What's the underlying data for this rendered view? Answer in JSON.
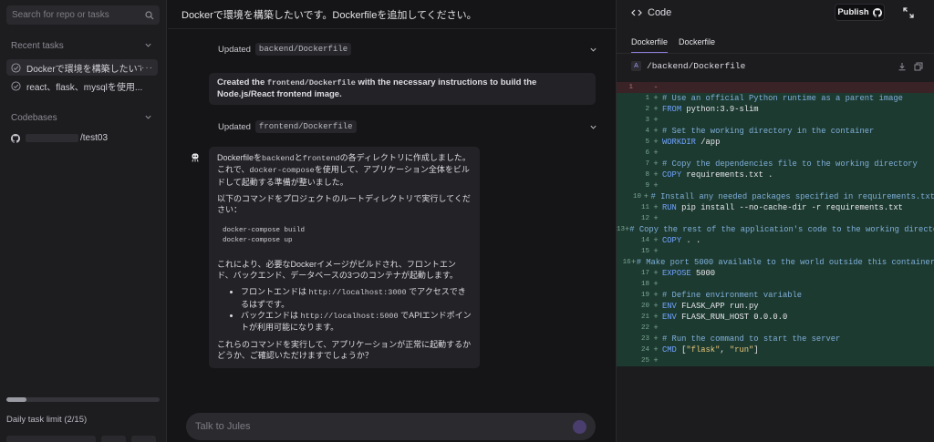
{
  "sidebar": {
    "search_placeholder": "Search for repo or tasks",
    "recent_tasks_label": "Recent tasks",
    "tasks": [
      {
        "label": "Dockerで環境を構築したいで...",
        "more": "···"
      },
      {
        "label": "react、flask、mysqlを使用..."
      }
    ],
    "codebases_label": "Codebases",
    "codebase": {
      "name": "/test03"
    },
    "daily_limit_text": "Daily task limit (2/15)",
    "daily_limit_fraction": 0.133
  },
  "chat": {
    "title": "Dockerで環境を構築したいです。Dockerfileを追加してください。",
    "updated1": {
      "label": "Updated",
      "path": "backend/Dockerfile"
    },
    "created_msg": {
      "pre": "Created the ",
      "code": "frontend/Dockerfile",
      "post": " with the necessary instructions to build the Node.js/React frontend image."
    },
    "updated2": {
      "label": "Updated",
      "path": "frontend/Dockerfile"
    },
    "reply": {
      "p1_a": "Dockerfileを",
      "p1_code1": "backend",
      "p1_b": "と",
      "p1_code2": "frontend",
      "p1_c": "の各ディレクトリに作成しました。これで、",
      "p1_code3": "docker-compose",
      "p1_d": "を使用して、アプリケーション全体をビルドして起動する準備が整いました。",
      "p2": "以下のコマンドをプロジェクトのルートディレクトリで実行してください：",
      "cmd1": "docker-compose build",
      "cmd2": "docker-compose up",
      "p3": "これにより、必要なDockerイメージがビルドされ、フロントエンド、バックエンド、データベースの3つのコンテナが起動します。",
      "li1_a": "フロントエンドは ",
      "li1_code": "http://localhost:3000",
      "li1_b": " でアクセスできるはずです。",
      "li2_a": "バックエンドは ",
      "li2_code": "http://localhost:5000",
      "li2_b": " でAPIエンドポイントが利用可能になります。",
      "p4": "これらのコマンドを実行して、アプリケーションが正常に起動するかどうか、ご確認いただけますでしょうか？"
    },
    "composer_placeholder": "Talk to Jules"
  },
  "panel": {
    "title": "Code",
    "publish_label": "Publish",
    "tabs": [
      "Dockerfile",
      "Dockerfile"
    ],
    "file_badge": "A",
    "file_path": "/backend/Dockerfile",
    "removed_line": {
      "old_no": "1",
      "sign": "-"
    },
    "lines": [
      {
        "n": "1",
        "t": "# Use an official Python runtime as a parent image",
        "k": "comment"
      },
      {
        "n": "2",
        "kw": "FROM",
        "t": " python:3.9-slim"
      },
      {
        "n": "3",
        "t": ""
      },
      {
        "n": "4",
        "t": "# Set the working directory in the container",
        "k": "comment"
      },
      {
        "n": "5",
        "kw": "WORKDIR",
        "t": " /app"
      },
      {
        "n": "6",
        "t": ""
      },
      {
        "n": "7",
        "t": "# Copy the dependencies file to the working directory",
        "k": "comment"
      },
      {
        "n": "8",
        "kw": "COPY",
        "t": " requirements.txt ."
      },
      {
        "n": "9",
        "t": ""
      },
      {
        "n": "10",
        "t": "# Install any needed packages specified in requirements.txt",
        "k": "comment"
      },
      {
        "n": "11",
        "kw": "RUN",
        "t": " pip install --no-cache-dir -r requirements.txt"
      },
      {
        "n": "12",
        "t": ""
      },
      {
        "n": "13",
        "t": "# Copy the rest of the application's code to the working directory",
        "k": "comment"
      },
      {
        "n": "14",
        "kw": "COPY",
        "t": " . ."
      },
      {
        "n": "15",
        "t": ""
      },
      {
        "n": "16",
        "t": "# Make port 5000 available to the world outside this container",
        "k": "comment"
      },
      {
        "n": "17",
        "kw": "EXPOSE",
        "t": " 5000"
      },
      {
        "n": "18",
        "t": ""
      },
      {
        "n": "19",
        "t": "# Define environment variable",
        "k": "comment"
      },
      {
        "n": "20",
        "kw": "ENV",
        "t": " FLASK_APP run.py"
      },
      {
        "n": "21",
        "kw": "ENV",
        "t": " FLASK_RUN_HOST 0.0.0.0"
      },
      {
        "n": "22",
        "t": ""
      },
      {
        "n": "23",
        "t": "# Run the command to start the server",
        "k": "comment"
      },
      {
        "n": "24",
        "kw": "CMD",
        "t": " [\"flask\", \"run\"]",
        "k": "cmd"
      },
      {
        "n": "25",
        "t": ""
      }
    ]
  },
  "colors": {
    "accent": "#8f7fd9",
    "added_bg": "#1d3a31",
    "removed_bg": "#3a2326"
  },
  "icons": [
    "search-icon",
    "chevron-down-icon",
    "check-circle-icon",
    "github-icon",
    "bot-icon",
    "code-icon",
    "fullscreen-icon",
    "download-icon",
    "copy-icon",
    "send-icon"
  ]
}
